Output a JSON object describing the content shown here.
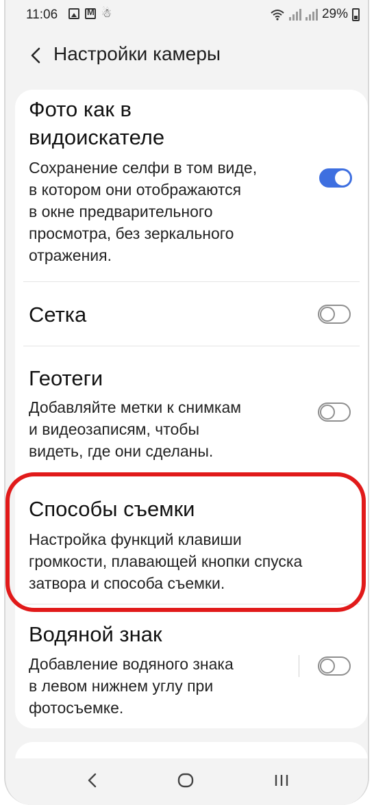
{
  "status_bar": {
    "time": "11:06",
    "battery": "29%"
  },
  "header": {
    "title": "Настройки камеры",
    "back_icon": "chevron-left-icon"
  },
  "settings": [
    {
      "title": "Фото как в видоискателе",
      "title_lines": [
        "Фото как в",
        "видоискателе"
      ],
      "description_lines": [
        "Сохранение селфи в том виде,",
        "в котором они отображаются",
        "в окне предварительного",
        "просмотра, без зеркального",
        "отражения."
      ],
      "toggle": "on"
    },
    {
      "title": "Сетка",
      "toggle": "off"
    },
    {
      "title": "Геотеги",
      "description_lines": [
        "Добавляйте метки к снимкам",
        "и видеозаписям, чтобы",
        "видеть, где они сделаны."
      ],
      "toggle": "off"
    },
    {
      "title": "Способы съемки",
      "description_lines": [
        "Настройка функций клавиши",
        "громкости, плавающей кнопки спуска",
        "затвора и способа съемки."
      ],
      "highlighted": true
    },
    {
      "title": "Водяной знак",
      "description_lines": [
        "Добавление водяного знака",
        "в левом нижнем углу при",
        "фотосъемке."
      ],
      "toggle": "off"
    }
  ],
  "colors": {
    "accent": "#3e6fe0",
    "highlight": "#e11a1a",
    "background": "#f3f3f3"
  },
  "nav": {
    "back_icon": "back-icon",
    "home_icon": "home-icon",
    "recents_icon": "recents-icon"
  }
}
